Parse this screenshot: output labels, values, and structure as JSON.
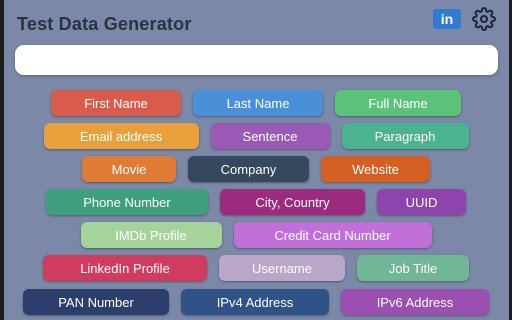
{
  "app": {
    "title": "Test Data Generator"
  },
  "header": {
    "linkedin_icon": "linkedin-icon",
    "settings_icon": "gear-icon",
    "linkedin_text": "in"
  },
  "search": {
    "value": "",
    "placeholder": ""
  },
  "buttons": [
    {
      "label": "First Name",
      "color": "#d85b4c"
    },
    {
      "label": "Last Name",
      "color": "#4a90d9"
    },
    {
      "label": "Full Name",
      "color": "#5cc27a"
    },
    {
      "label": "Email address",
      "color": "#e8a03c"
    },
    {
      "label": "Sentence",
      "color": "#9b59b6"
    },
    {
      "label": "Paragraph",
      "color": "#4cb38f"
    },
    {
      "label": "Movie",
      "color": "#e07b35"
    },
    {
      "label": "Company",
      "color": "#34495e"
    },
    {
      "label": "Website",
      "color": "#d35f23"
    },
    {
      "label": "Phone Number",
      "color": "#3e9f7c"
    },
    {
      "label": "City, Country",
      "color": "#9c2b7e"
    },
    {
      "label": "UUID",
      "color": "#8e44ad"
    },
    {
      "label": "IMDb Profile",
      "color": "#a6d39b"
    },
    {
      "label": "Credit Card Number",
      "color": "#c16fd9"
    },
    {
      "label": "LinkedIn Profile",
      "color": "#d13b5e"
    },
    {
      "label": "Username",
      "color": "#b9a6c9"
    },
    {
      "label": "Job Title",
      "color": "#6fb795"
    },
    {
      "label": "PAN Number",
      "color": "#2c3e6b"
    },
    {
      "label": "IPv4 Address",
      "color": "#2f5287"
    },
    {
      "label": "IPv6 Address",
      "color": "#9b4fb0"
    }
  ]
}
